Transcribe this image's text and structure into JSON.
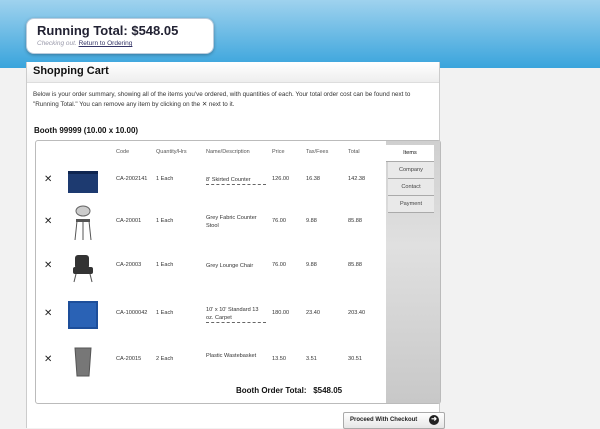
{
  "running_total": {
    "label": "Running Total: $548.05",
    "status": "Checking out.",
    "return_link": "Return to Ordering"
  },
  "cart": {
    "title": "Shopping Cart",
    "intro": "Below is your order summary, showing all of the items you've ordered, with quantities of each. Your total order cost can be found next to \"Running Total.\" You can remove any item by clicking on the ✕ next to it.",
    "booth": "Booth 99999 (10.00 x 10.00)",
    "columns": {
      "code": "Code",
      "qty": "Quantity/Hrs",
      "name": "Name/Description",
      "price": "Price",
      "tax": "Tax/Fees",
      "total": "Total"
    },
    "rows": [
      {
        "code": "CA-2002141",
        "qty": "1 Each",
        "name": "8' Skirted Counter",
        "price": "126.00",
        "tax": "16.38",
        "total": "142.38",
        "link": true
      },
      {
        "code": "CA-20001",
        "qty": "1 Each",
        "name": "Grey Fabric Counter Stool",
        "price": "76.00",
        "tax": "9.88",
        "total": "85.88",
        "link": false
      },
      {
        "code": "CA-20003",
        "qty": "1 Each",
        "name": "Grey Lounge Chair",
        "price": "76.00",
        "tax": "9.88",
        "total": "85.88",
        "link": false
      },
      {
        "code": "CA-1000042",
        "qty": "1 Each",
        "name": "10' x 10' Standard 13 oz. Carpet",
        "price": "180.00",
        "tax": "23.40",
        "total": "203.40",
        "link": true
      },
      {
        "code": "CA-20015",
        "qty": "2 Each",
        "name": "Plastic Wastebasket",
        "price": "13.50",
        "tax": "3.51",
        "total": "30.51",
        "link": false
      }
    ],
    "booth_total_label": "Booth Order Total:",
    "booth_total": "$548.05"
  },
  "tabs": [
    "Items",
    "Company",
    "Contact",
    "Payment"
  ],
  "proceed_label": "Proceed With Checkout"
}
